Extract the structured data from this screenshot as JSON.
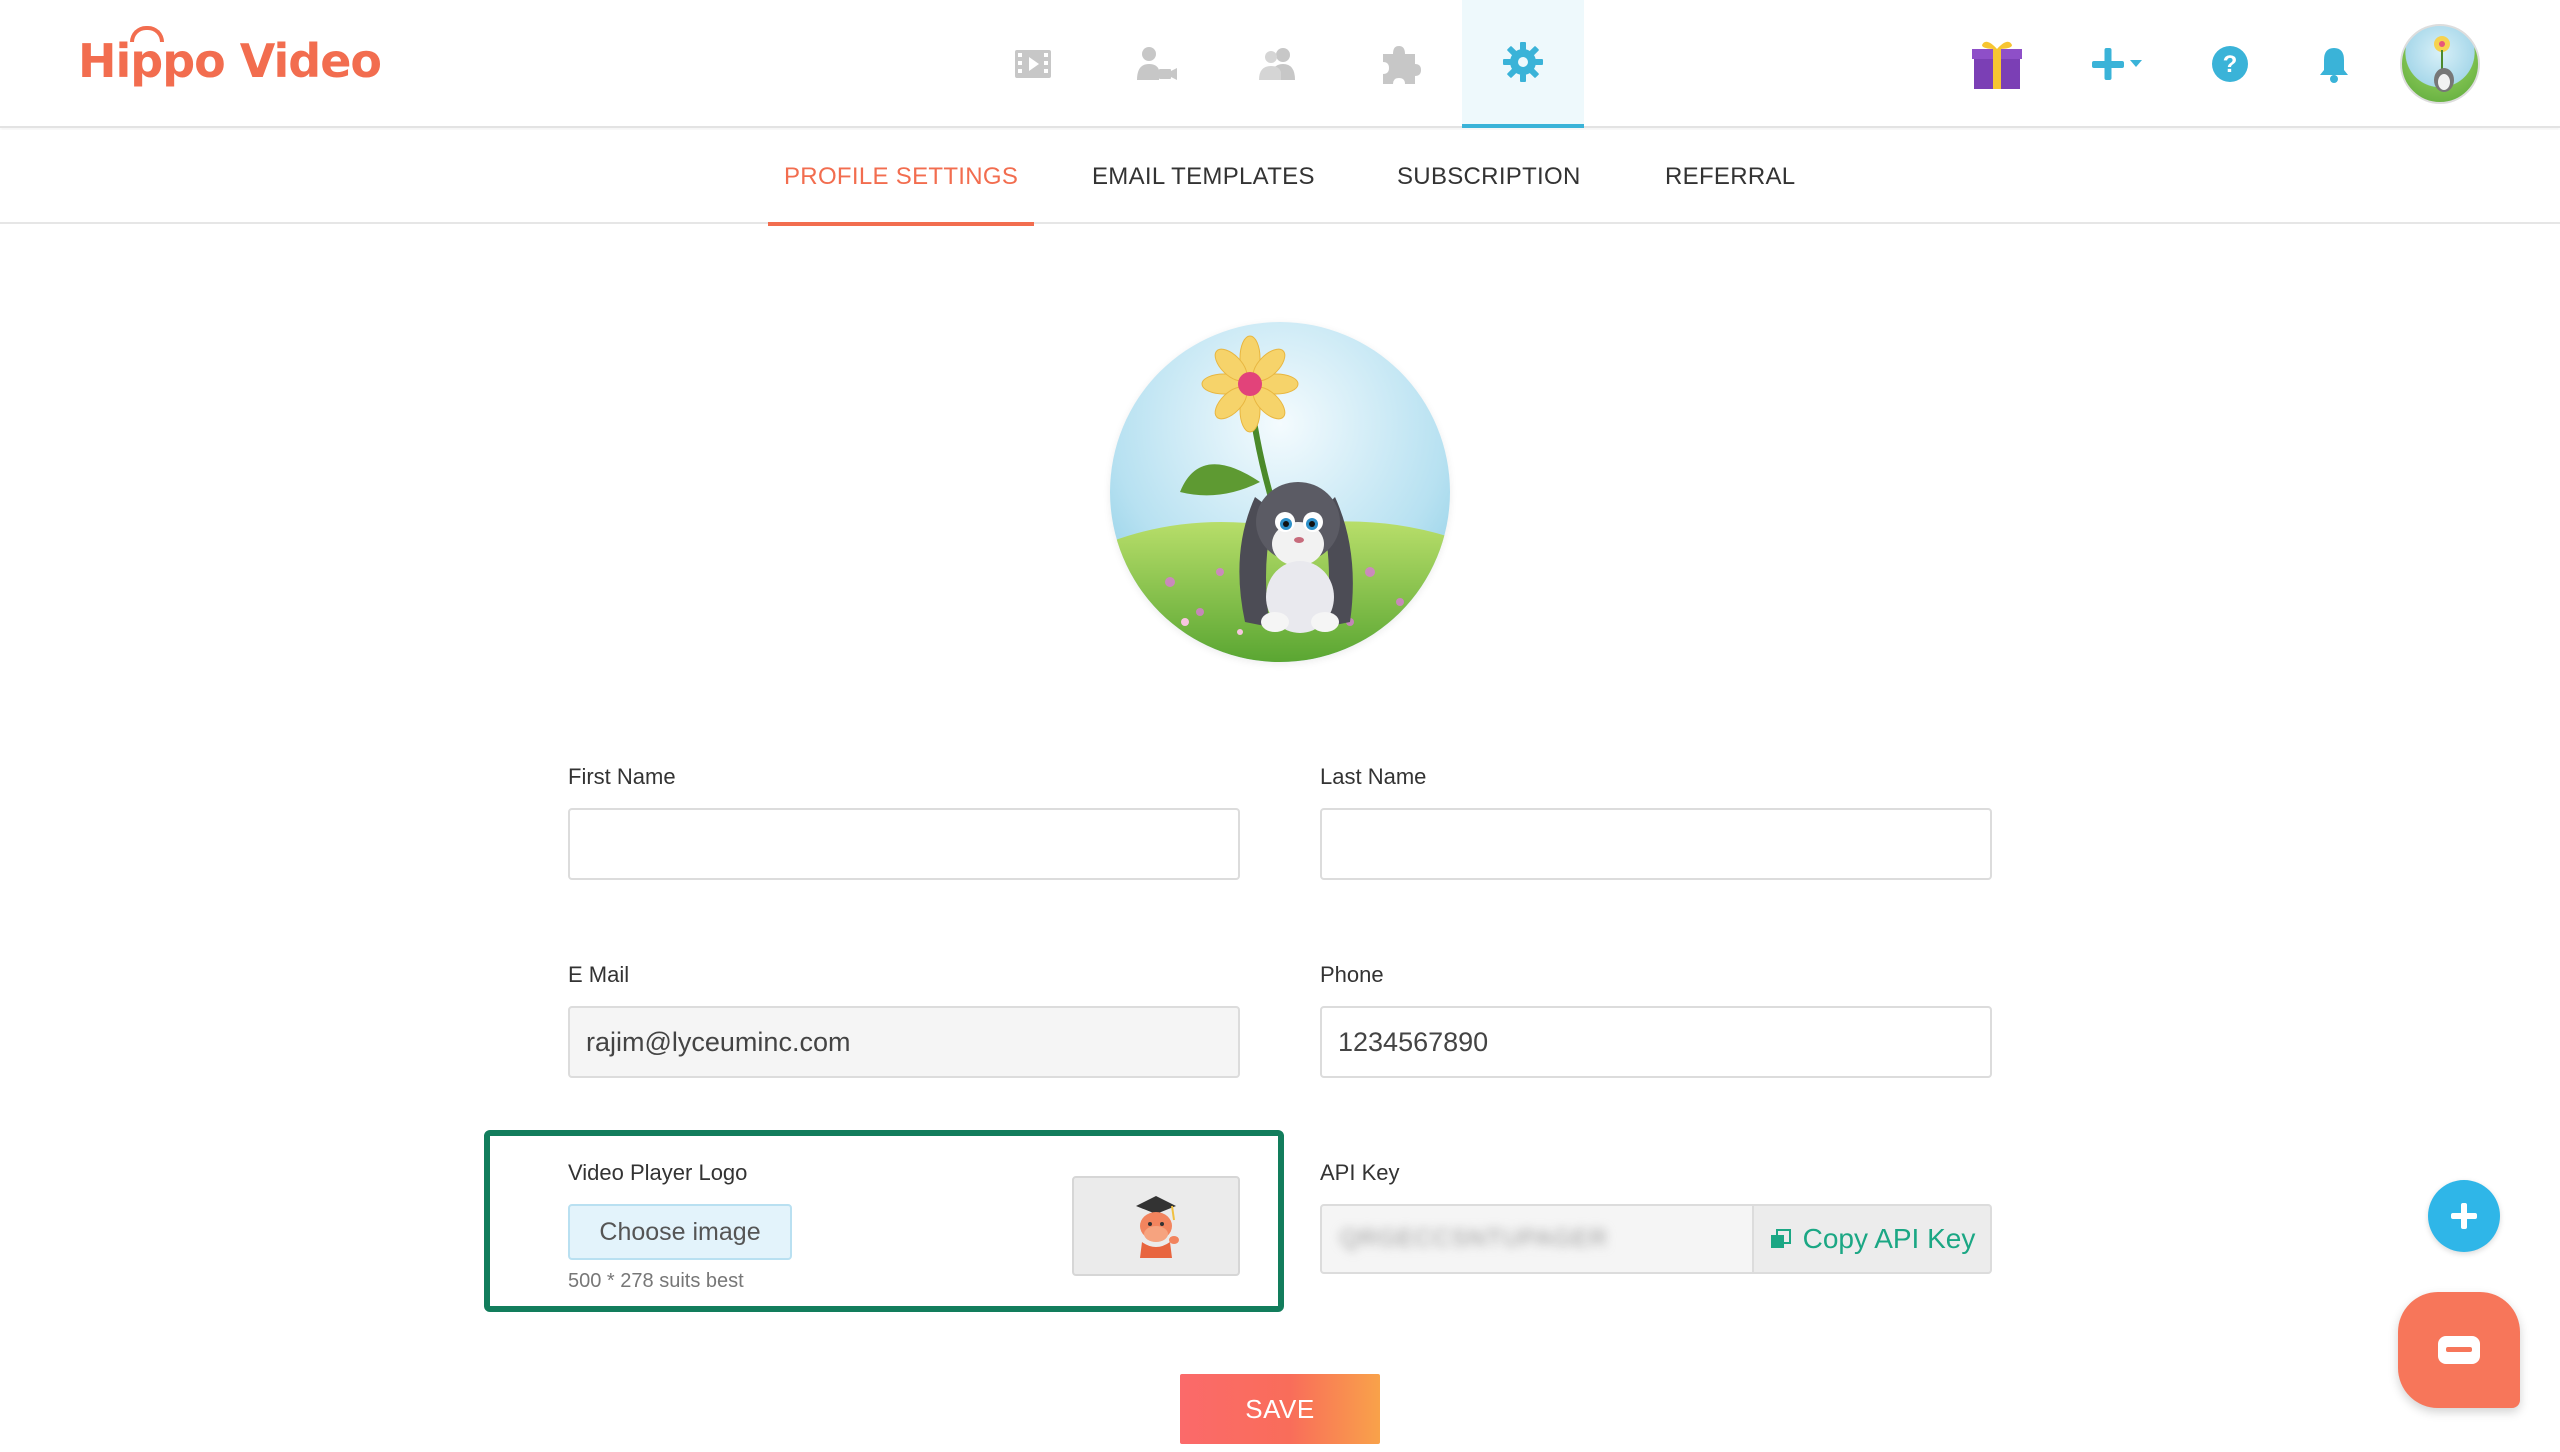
{
  "app": {
    "logo_text": "Hippo Video",
    "brand_color": "#f26d4f",
    "accent_color": "#3ab3d8"
  },
  "main_nav": [
    {
      "icon": "video-film-icon",
      "active": false
    },
    {
      "icon": "person-camera-icon",
      "active": false
    },
    {
      "icon": "contacts-icon",
      "active": false
    },
    {
      "icon": "puzzle-integrations-icon",
      "active": false
    },
    {
      "icon": "settings-gear-icon",
      "active": true
    }
  ],
  "toolbar": {
    "gift_icon": "gift-icon",
    "create_icon": "plus-dropdown-icon",
    "help_icon": "help-icon",
    "notifications_icon": "bell-icon",
    "avatar": "user-avatar"
  },
  "subnav": {
    "tabs": [
      {
        "label": "PROFILE SETTINGS",
        "active": true
      },
      {
        "label": "EMAIL TEMPLATES",
        "active": false
      },
      {
        "label": "SUBSCRIPTION",
        "active": false
      },
      {
        "label": "REFERRAL",
        "active": false
      }
    ]
  },
  "form": {
    "first_name": {
      "label": "First Name",
      "value": ""
    },
    "last_name": {
      "label": "Last Name",
      "value": ""
    },
    "email": {
      "label": "E Mail",
      "value": "rajim@lyceuminc.com"
    },
    "phone": {
      "label": "Phone",
      "value": "1234567890"
    },
    "video_logo": {
      "label": "Video Player Logo",
      "choose_label": "Choose image",
      "hint": "500 * 278 suits best"
    },
    "api_key": {
      "label": "API Key",
      "value": "QRGECCSNTUPAGER",
      "copy_label": "Copy API Key"
    },
    "save_label": "SAVE"
  },
  "colors": {
    "highlight_border": "#127d5c",
    "copy_text": "#1ba784",
    "fab": "#2fb6e8",
    "chat": "#f7765a"
  }
}
